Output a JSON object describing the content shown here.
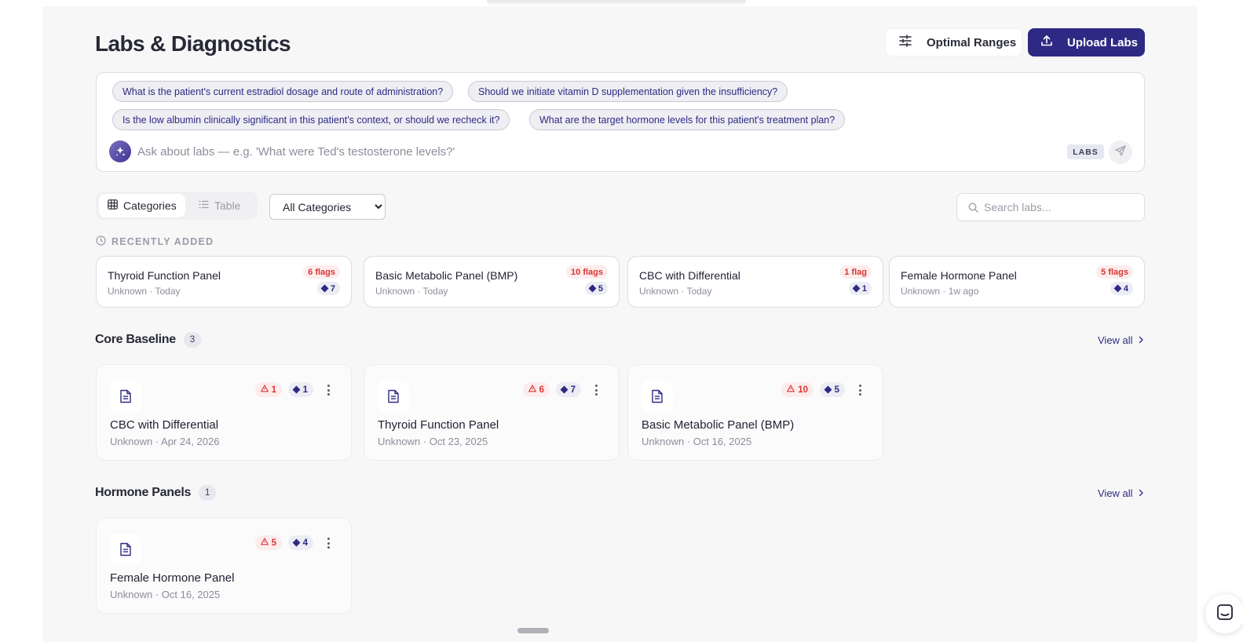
{
  "header": {
    "title": "Labs & Diagnostics",
    "optimal_ranges_label": "Optimal Ranges",
    "upload_labs_label": "Upload Labs"
  },
  "ask": {
    "suggestions": [
      "What is the patient's current estradiol dosage and route of administration?",
      "Should we initiate vitamin D supplementation given the insufficiency?",
      "Is the low albumin clinically significant in this patient's context, or should we recheck it?",
      "What are the target hormone levels for this patient's treatment plan?"
    ],
    "placeholder": "Ask about labs — e.g. 'What were Ted's testosterone levels?'",
    "tag": "LABS"
  },
  "toolbar": {
    "view_categories": "Categories",
    "view_table": "Table",
    "category_filter": "All Categories",
    "search_placeholder": "Search labs..."
  },
  "recent": {
    "label": "RECENTLY ADDED",
    "items": [
      {
        "title": "Thyroid Function Panel",
        "sub": "Unknown · Today",
        "flags": "6 flags",
        "count": "7"
      },
      {
        "title": "Basic Metabolic Panel (BMP)",
        "sub": "Unknown · Today",
        "flags": "10 flags",
        "count": "5"
      },
      {
        "title": "CBC with Differential",
        "sub": "Unknown · Today",
        "flags": "1 flag",
        "count": "1"
      },
      {
        "title": "Female Hormone Panel",
        "sub": "Unknown · 1w ago",
        "flags": "5 flags",
        "count": "4"
      }
    ]
  },
  "sections": [
    {
      "title": "Core Baseline",
      "count": "3",
      "view_all": "View all",
      "cards": [
        {
          "title": "CBC with Differential",
          "sub": "Unknown · Apr 24, 2026",
          "warnings": "1",
          "count": "1"
        },
        {
          "title": "Thyroid Function Panel",
          "sub": "Unknown · Oct 23, 2025",
          "warnings": "6",
          "count": "7"
        },
        {
          "title": "Basic Metabolic Panel (BMP)",
          "sub": "Unknown · Oct 16, 2025",
          "warnings": "10",
          "count": "5"
        }
      ]
    },
    {
      "title": "Hormone Panels",
      "count": "1",
      "view_all": "View all",
      "cards": [
        {
          "title": "Female Hormone Panel",
          "sub": "Unknown · Oct 16, 2025",
          "warnings": "5",
          "count": "4"
        }
      ]
    }
  ],
  "icons": {
    "sliders": "sliders-icon",
    "upload": "upload-icon",
    "sparkle": "sparkle-icon",
    "send": "send-icon",
    "grid": "grid-icon",
    "list": "list-icon",
    "search": "search-icon",
    "clock": "clock-icon",
    "document": "document-icon",
    "warning": "warning-icon",
    "diamond": "diamond-icon",
    "more": "more-vertical-icon",
    "chevron": "chevron-right-icon",
    "chat": "chat-icon"
  },
  "colors": {
    "accent": "#2e2a84",
    "flag": "#d93636",
    "background": "#f7f7f8"
  }
}
